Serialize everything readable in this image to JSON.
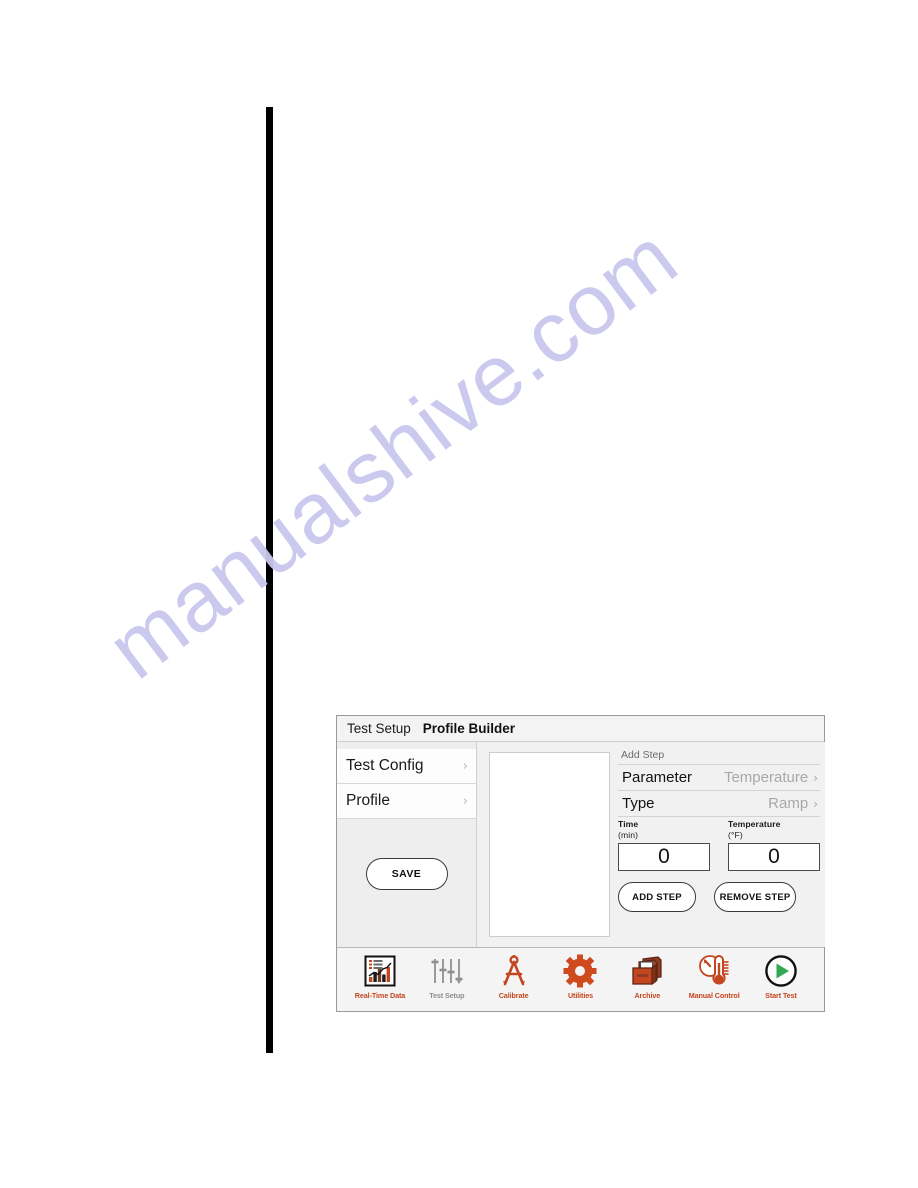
{
  "page": {
    "watermark_text": "manualshive.com",
    "watermark_color": "#c9c7ee",
    "vertical_rule_color": "#000000"
  },
  "device": {
    "header": {
      "breadcrumb": "Test Setup",
      "title": "Profile Builder"
    },
    "left_nav": {
      "items": [
        {
          "label": "Test Config",
          "chevron": "›"
        },
        {
          "label": "Profile",
          "chevron": "›"
        }
      ],
      "save_label": "SAVE"
    },
    "content": {
      "step_list": {
        "items": []
      },
      "add_step": {
        "caption": "Add Step",
        "rows": [
          {
            "label": "Parameter",
            "value": "Temperature",
            "chevron": "›"
          },
          {
            "label": "Type",
            "value": "Ramp",
            "chevron": "›"
          }
        ],
        "fields": [
          {
            "label": "Time",
            "unit": "(min)",
            "value": "0"
          },
          {
            "label": "Temperature",
            "unit": "(°F)",
            "value": "0"
          }
        ],
        "buttons": [
          {
            "label": "ADD STEP"
          },
          {
            "label": "REMOVE STEP"
          }
        ]
      }
    },
    "toolbar": {
      "accent_color": "#c4461f",
      "disabled_color": "#8e8e8e",
      "items": [
        {
          "label": "Real-Time Data",
          "icon": "bar-line-chart-icon",
          "active": false
        },
        {
          "label": "Test Setup",
          "icon": "sliders-icon",
          "active": true
        },
        {
          "label": "Calibrate",
          "icon": "compass-divider-icon",
          "active": false
        },
        {
          "label": "Utilities",
          "icon": "gear-icon",
          "active": false
        },
        {
          "label": "Archive",
          "icon": "file-box-icon",
          "active": false
        },
        {
          "label": "Manual Control",
          "icon": "gauge-thermometer-icon",
          "active": false
        },
        {
          "label": "Start Test",
          "icon": "play-circle-icon",
          "active": false
        }
      ]
    }
  }
}
